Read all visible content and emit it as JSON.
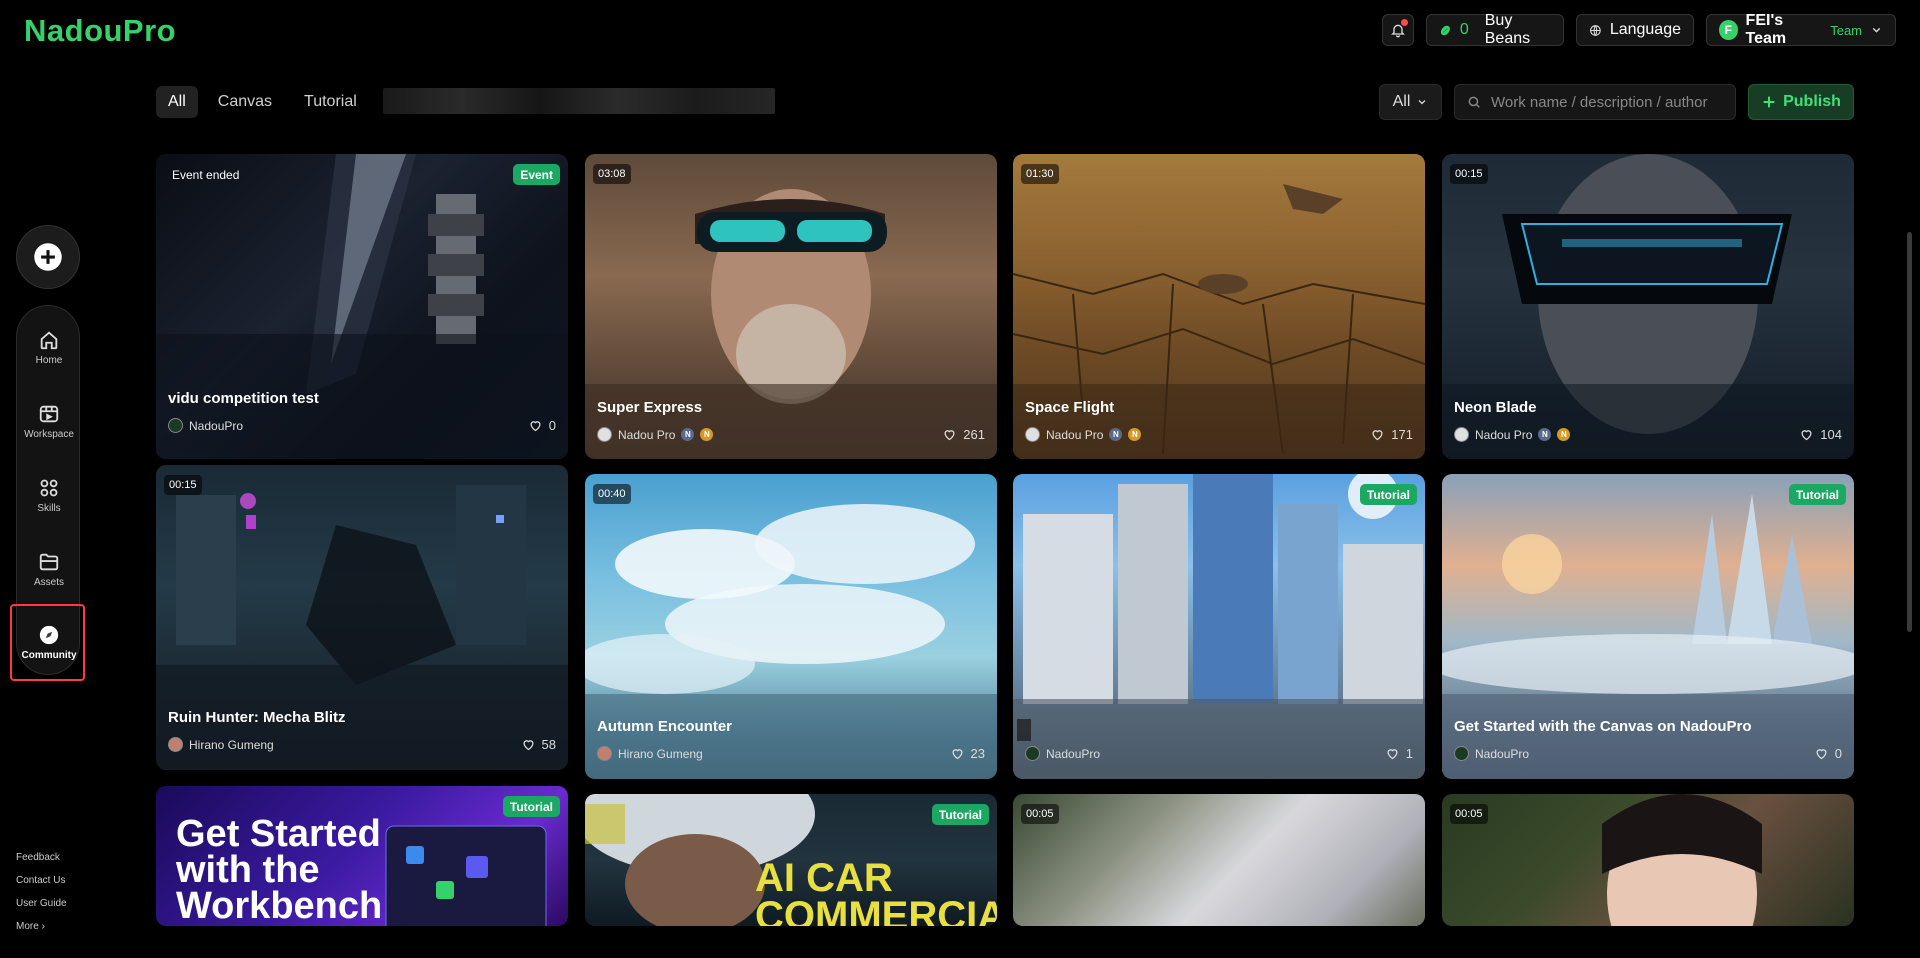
{
  "header": {
    "logo": "NadouPro",
    "beans_count": "0",
    "buy_beans_label": "Buy Beans",
    "language_label": "Language",
    "team_initial": "F",
    "team_name": "FEI's Team",
    "team_tag": "Team"
  },
  "filters": {
    "tabs": [
      {
        "label": "All",
        "active": true
      },
      {
        "label": "Canvas",
        "active": false
      },
      {
        "label": "Tutorial",
        "active": false
      }
    ],
    "select_value": "All",
    "search_placeholder": "Work name / description / author",
    "publish_label": "Publish"
  },
  "sidebar": {
    "items": [
      {
        "label": "Home",
        "icon": "home-icon"
      },
      {
        "label": "Workspace",
        "icon": "workspace-icon"
      },
      {
        "label": "Skills",
        "icon": "skills-icon"
      },
      {
        "label": "Assets",
        "icon": "folder-icon"
      },
      {
        "label": "Community",
        "icon": "compass-icon",
        "active": true
      }
    ],
    "footer_links": [
      "Feedback",
      "Contact Us",
      "User Guide",
      "More"
    ]
  },
  "cards": [
    {
      "title": "vidu competition test",
      "author": "NadouPro",
      "likes": "0",
      "status": "Event ended",
      "tag": "Event",
      "duration": ""
    },
    {
      "title": "Super Express",
      "author": "Nadou Pro",
      "likes": "261",
      "duration": "03:08",
      "tag": ""
    },
    {
      "title": "Space Flight",
      "author": "Nadou Pro",
      "likes": "171",
      "duration": "01:30",
      "tag": ""
    },
    {
      "title": "Neon Blade",
      "author": "Nadou Pro",
      "likes": "104",
      "duration": "00:15",
      "tag": ""
    },
    {
      "title": "Ruin Hunter: Mecha Blitz",
      "author": "Hirano Gumeng",
      "likes": "58",
      "duration": "00:15",
      "tag": ""
    },
    {
      "title": "Autumn Encounter",
      "author": "Hirano Gumeng",
      "likes": "23",
      "duration": "00:40",
      "tag": ""
    },
    {
      "title": "",
      "author": "NadouPro",
      "likes": "1",
      "duration": "",
      "tag": "Tutorial"
    },
    {
      "title": "Get Started with the Canvas on NadouPro",
      "author": "NadouPro",
      "likes": "0",
      "duration": "",
      "tag": "Tutorial"
    },
    {
      "title": "",
      "author": "",
      "likes": "",
      "duration": "",
      "tag": "Tutorial",
      "image_text": "Get Started with the Workbench"
    },
    {
      "title": "",
      "author": "",
      "likes": "",
      "duration": "",
      "tag": "Tutorial",
      "image_text": "AI CAR COMMERCIAL"
    },
    {
      "title": "",
      "author": "",
      "likes": "",
      "duration": "00:05",
      "tag": ""
    },
    {
      "title": "",
      "author": "",
      "likes": "",
      "duration": "00:05",
      "tag": ""
    }
  ]
}
